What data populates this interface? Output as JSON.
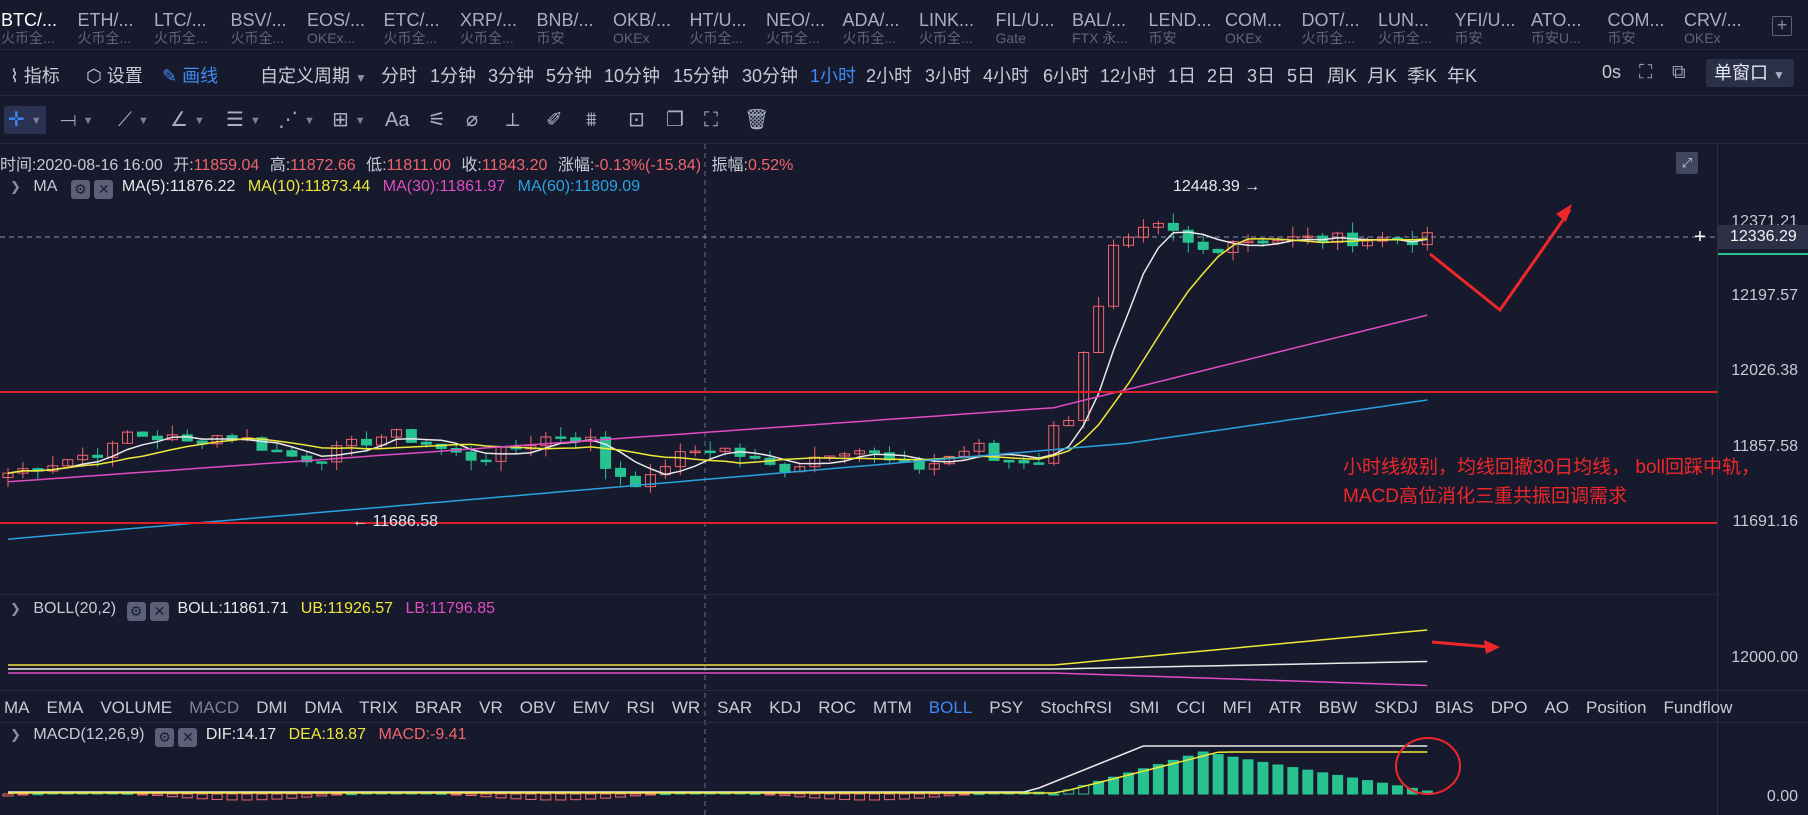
{
  "symbols": [
    {
      "name": "BTC/...",
      "exchange": "火币全...",
      "active": true
    },
    {
      "name": "ETH/...",
      "exchange": "火币全..."
    },
    {
      "name": "LTC/...",
      "exchange": "火币全..."
    },
    {
      "name": "BSV/...",
      "exchange": "火币全..."
    },
    {
      "name": "EOS/...",
      "exchange": "OKEx..."
    },
    {
      "name": "ETC/...",
      "exchange": "火币全..."
    },
    {
      "name": "XRP/...",
      "exchange": "火币全..."
    },
    {
      "name": "BNB/...",
      "exchange": "币安"
    },
    {
      "name": "OKB/...",
      "exchange": "OKEx"
    },
    {
      "name": "HT/U...",
      "exchange": "火币全..."
    },
    {
      "name": "NEO/...",
      "exchange": "火币全..."
    },
    {
      "name": "ADA/...",
      "exchange": "火币全..."
    },
    {
      "name": "LINK...",
      "exchange": "火币全..."
    },
    {
      "name": "FIL/U...",
      "exchange": "Gate"
    },
    {
      "name": "BAL/...",
      "exchange": "FTX 永..."
    },
    {
      "name": "LEND...",
      "exchange": "币安"
    },
    {
      "name": "COM...",
      "exchange": "OKEx"
    },
    {
      "name": "DOT/...",
      "exchange": "火币全..."
    },
    {
      "name": "LUN...",
      "exchange": "火币全..."
    },
    {
      "name": "YFI/U...",
      "exchange": "币安"
    },
    {
      "name": "ATO...",
      "exchange": "币安U..."
    },
    {
      "name": "COM...",
      "exchange": "币安"
    },
    {
      "name": "CRV/...",
      "exchange": "OKEx"
    }
  ],
  "toolbar": {
    "indicator_label": "指标",
    "settings_label": "设置",
    "draw_label": "画线",
    "custom_period_label": "自定义周期",
    "periods": [
      "分时",
      "1分钟",
      "3分钟",
      "5分钟",
      "10分钟",
      "15分钟",
      "30分钟",
      "1小时",
      "2小时",
      "3小时",
      "4小时",
      "6小时",
      "12小时",
      "1日",
      "2日",
      "3日",
      "5日",
      "周K",
      "月K",
      "季K",
      "年K"
    ],
    "active_period": "1小时",
    "countdown": "0s",
    "window_label": "单窗口"
  },
  "drawing_tools": [
    "crosshair-tool",
    "horizontal-line-tool",
    "trend-line-tool",
    "angle-tool",
    "parallel-lines-tool",
    "wave-tool",
    "measure-tool",
    "text-tool",
    "fib-tool",
    "magnet-tool",
    "ruler-tool",
    "brush-tool",
    "pattern-tool",
    "lock-tool",
    "copy-tool",
    "screenshot-tool",
    "delete-tool"
  ],
  "drawing_text_tool_label": "Aa",
  "ohlc": {
    "time_label": "时间:",
    "time": "2020-08-16 16:00",
    "open_label": "开:",
    "open": "11859.04",
    "high_label": "高:",
    "high": "11872.66",
    "low_label": "低:",
    "low": "11811.00",
    "close_label": "收:",
    "close": "11843.20",
    "change_label": "涨幅:",
    "change": "-0.13%(-15.84)",
    "amp_label": "振幅:",
    "amp": "0.52%"
  },
  "ma": {
    "name": "MA",
    "ma5": "MA(5):11876.22",
    "ma10": "MA(10):11873.44",
    "ma30": "MA(30):11861.97",
    "ma60": "MA(60):11809.09"
  },
  "boll": {
    "name": "BOLL(20,2)",
    "mid": "BOLL:11861.71",
    "ub": "UB:11926.57",
    "lb": "LB:11796.85"
  },
  "macd": {
    "name": "MACD(12,26,9)",
    "dif": "DIF:14.17",
    "dea": "DEA:18.87",
    "macd": "MACD:-9.41"
  },
  "price_axis": [
    "12371.21",
    "12197.57",
    "12026.38",
    "11857.58",
    "11691.16"
  ],
  "current_price": "12336.29",
  "high_marker": "12448.39 →",
  "low_marker": "← 11686.58",
  "boll_axis": "12000.00",
  "macd_axis": "0.00",
  "indicator_tabs": [
    "MA",
    "EMA",
    "VOLUME",
    "MACD",
    "DMI",
    "DMA",
    "TRIX",
    "BRAR",
    "VR",
    "OBV",
    "EMV",
    "RSI",
    "WR",
    "SAR",
    "KDJ",
    "ROC",
    "MTM",
    "BOLL",
    "PSY",
    "StochRSI",
    "SMI",
    "CCI",
    "MFI",
    "ATR",
    "BBW",
    "SKDJ",
    "BIAS",
    "DPO",
    "AO",
    "Position",
    "Fundflow"
  ],
  "indicator_tabs_active": "BOLL",
  "indicator_tabs_muted": "MACD",
  "annotation": {
    "line1": "小时线级别，均线回撤30日均线， boll回踩中轨，",
    "line2": "MACD高位消化三重共振回调需求"
  },
  "colors": {
    "up": "#f1646c",
    "down": "#27c290",
    "ma5": "#e8e8e8",
    "ma10": "#f0e83a",
    "ma30": "#e04cc4",
    "ma60": "#2ba2e0",
    "annotation": "#f0272a",
    "active": "#3f8bf5"
  }
}
